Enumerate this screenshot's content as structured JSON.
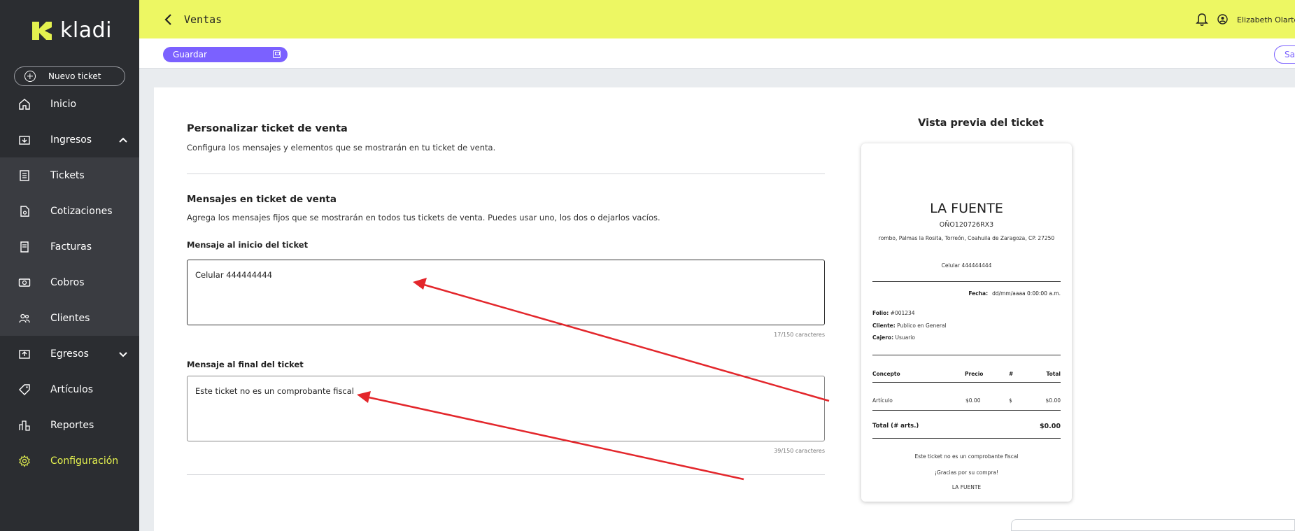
{
  "brand": {
    "name": "kladi",
    "accent": "#e4f14f",
    "logo_color": "#e4f14f"
  },
  "sidebar": {
    "new_ticket_label": "Nuevo ticket",
    "items": [
      {
        "label": "Inicio",
        "icon": "home-icon"
      },
      {
        "label": "Ingresos",
        "icon": "income-icon",
        "expanded": true
      },
      {
        "label": "Tickets",
        "icon": "ticket-icon"
      },
      {
        "label": "Cotizaciones",
        "icon": "quote-icon"
      },
      {
        "label": "Facturas",
        "icon": "invoice-icon"
      },
      {
        "label": "Cobros",
        "icon": "money-icon"
      },
      {
        "label": "Clientes",
        "icon": "users-icon"
      },
      {
        "label": "Egresos",
        "icon": "expenses-icon",
        "expanded": false
      },
      {
        "label": "Artículos",
        "icon": "tag-icon"
      },
      {
        "label": "Reportes",
        "icon": "reports-icon"
      },
      {
        "label": "Configuración",
        "icon": "gear-icon",
        "active": true
      }
    ]
  },
  "topbar": {
    "title": "Ventas",
    "user_name": "Elizabeth Olarte",
    "background": "#edf763"
  },
  "toolbar": {
    "save_label": "Guardar",
    "exit_label": "Sal",
    "accent": "#7b61ff"
  },
  "form": {
    "title": "Personalizar ticket de venta",
    "subtitle": "Configura los mensajes y elementos que se mostrarán en tu ticket de venta.",
    "messages_title": "Mensajes en ticket de venta",
    "messages_subtitle": "Agrega los mensajes fijos que se mostrarán en todos tus tickets de venta. Puedes usar uno, los dos o dejarlos vacíos.",
    "start_label": "Mensaje al inicio del ticket",
    "start_value": "Celular 444444444",
    "start_counter": "17/150 caracteres",
    "end_label": "Mensaje al final del ticket",
    "end_value": "Este ticket no es un comprobante fiscal",
    "end_counter": "39/150 caracteres"
  },
  "preview": {
    "title": "Vista previa del ticket",
    "business": "LA FUENTE",
    "rfc": "OÑO120726RX3",
    "address": "rombo, Palmas la Rosita, Torreón, Coahuila de Zaragoza, CP. 27250",
    "start_message": "Celular 444444444",
    "date_label": "Fecha:",
    "date_value": "dd/mm/aaaa 0:00:00 a.m.",
    "folio_label": "Folio:",
    "folio_value": "#001234",
    "client_label": "Cliente:",
    "client_value": "Publico en General",
    "cashier_label": "Cajero:",
    "cashier_value": "Usuario",
    "columns": [
      "Concepto",
      "Precio",
      "#",
      "Total"
    ],
    "row": [
      "Artículo",
      "$0.00",
      "$",
      "$0.00"
    ],
    "total_label": "Total (# arts.)",
    "total_value": "$0.00",
    "end_message": "Este ticket no es un comprobante fiscal",
    "thanks": "¡Gracias por su compra!",
    "footer_name": "LA FUENTE"
  },
  "annotation": {
    "arrow_color": "#e3262b"
  }
}
